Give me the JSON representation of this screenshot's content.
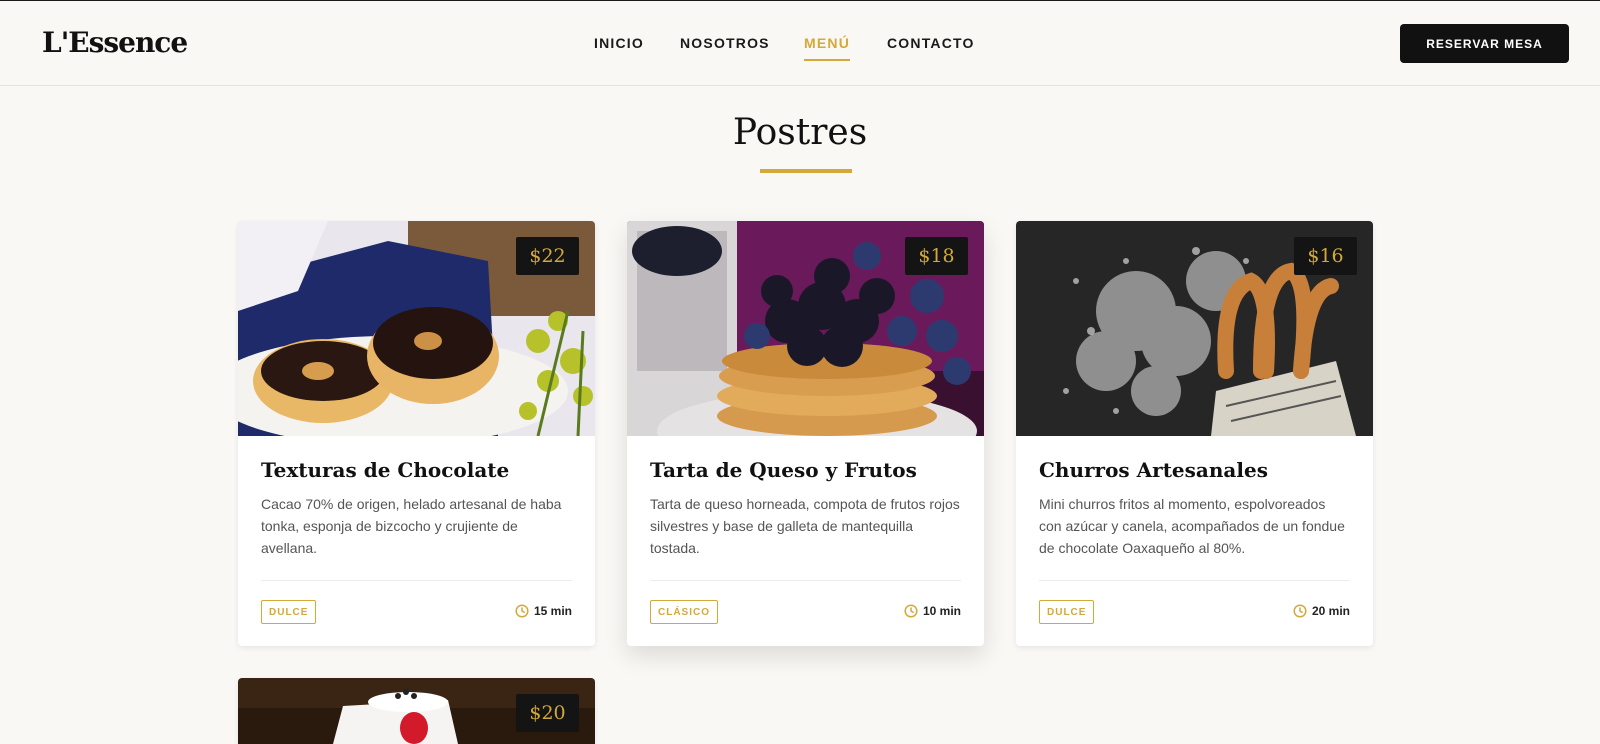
{
  "header": {
    "logo": "L'Essence",
    "nav": [
      {
        "label": "INICIO",
        "active": false
      },
      {
        "label": "NOSOTROS",
        "active": false
      },
      {
        "label": "MENÚ",
        "active": true
      },
      {
        "label": "CONTACTO",
        "active": false
      }
    ],
    "cta_label": "RESERVAR MESA"
  },
  "section": {
    "title": "Postres"
  },
  "cards": [
    {
      "image": "chocolate-donuts-photo",
      "price": "$22",
      "title": "Texturas de Chocolate",
      "description": "Cacao 70% de origen, helado artesanal de haba tonka, esponja de bizcocho y crujiente de avellana.",
      "tag": "DULCE",
      "time": "15 min"
    },
    {
      "image": "berry-pancakes-photo",
      "price": "$18",
      "title": "Tarta de Queso y Frutos",
      "description": "Tarta de queso horneada, compota de frutos rojos silvestres y base de galleta de mantequilla tostada.",
      "tag": "CLÁSICO",
      "time": "10 min"
    },
    {
      "image": "churros-photo",
      "price": "$16",
      "title": "Churros Artesanales",
      "description": "Mini churros fritos al momento, espolvoreados con azúcar y canela, acompañados de un fondue de chocolate Oaxaqueño al 80%.",
      "tag": "DULCE",
      "time": "20 min"
    },
    {
      "image": "strawberry-cake-photo",
      "price": "$20"
    }
  ],
  "colors": {
    "accent": "#d4a93a",
    "dark": "#111111",
    "background": "#faf8f5"
  },
  "icons": {
    "time": "clock-icon"
  }
}
